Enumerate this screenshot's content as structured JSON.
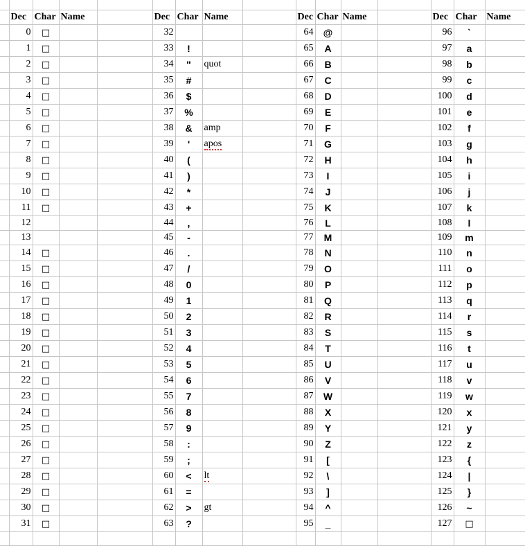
{
  "document": {
    "type": "spreadsheet",
    "title": "ASCII Character Table",
    "grid_line_color": "#c6c6c6",
    "page_break_color": "#8a8a8a",
    "background": "#ffffff",
    "spellcheck_underline_color": "#d03030"
  },
  "headers": {
    "dec": "Dec",
    "char": "Char",
    "name": "Name"
  },
  "groups": [
    {
      "id": "group-1",
      "header": {
        "dec": "Dec",
        "char": "Char",
        "name": "Name"
      },
      "rows": [
        {
          "dec": "0",
          "char": "□",
          "name": "",
          "box": true
        },
        {
          "dec": "1",
          "char": "□",
          "name": "",
          "box": true
        },
        {
          "dec": "2",
          "char": "□",
          "name": "",
          "box": true
        },
        {
          "dec": "3",
          "char": "□",
          "name": "",
          "box": true
        },
        {
          "dec": "4",
          "char": "□",
          "name": "",
          "box": true
        },
        {
          "dec": "5",
          "char": "□",
          "name": "",
          "box": true
        },
        {
          "dec": "6",
          "char": "□",
          "name": "",
          "box": true
        },
        {
          "dec": "7",
          "char": "□",
          "name": "",
          "box": true
        },
        {
          "dec": "8",
          "char": "□",
          "name": "",
          "box": true
        },
        {
          "dec": "9",
          "char": "□",
          "name": "",
          "box": true
        },
        {
          "dec": "10",
          "char": "□",
          "name": "",
          "box": true
        },
        {
          "dec": "11",
          "char": "□",
          "name": "",
          "box": true
        },
        {
          "dec": "12",
          "char": "",
          "name": ""
        },
        {
          "dec": "13",
          "char": "",
          "name": ""
        },
        {
          "dec": "14",
          "char": "□",
          "name": "",
          "box": true
        },
        {
          "dec": "15",
          "char": "□",
          "name": "",
          "box": true
        },
        {
          "dec": "16",
          "char": "□",
          "name": "",
          "box": true
        },
        {
          "dec": "17",
          "char": "□",
          "name": "",
          "box": true
        },
        {
          "dec": "18",
          "char": "□",
          "name": "",
          "box": true
        },
        {
          "dec": "19",
          "char": "□",
          "name": "",
          "box": true
        },
        {
          "dec": "20",
          "char": "□",
          "name": "",
          "box": true
        },
        {
          "dec": "21",
          "char": "□",
          "name": "",
          "box": true
        },
        {
          "dec": "22",
          "char": "□",
          "name": "",
          "box": true
        },
        {
          "dec": "23",
          "char": "□",
          "name": "",
          "box": true
        },
        {
          "dec": "24",
          "char": "□",
          "name": "",
          "box": true
        },
        {
          "dec": "25",
          "char": "□",
          "name": "",
          "box": true
        },
        {
          "dec": "26",
          "char": "□",
          "name": "",
          "box": true
        },
        {
          "dec": "27",
          "char": "□",
          "name": "",
          "box": true
        },
        {
          "dec": "28",
          "char": "□",
          "name": "",
          "box": true
        },
        {
          "dec": "29",
          "char": "□",
          "name": "",
          "box": true
        },
        {
          "dec": "30",
          "char": "□",
          "name": "",
          "box": true
        },
        {
          "dec": "31",
          "char": "□",
          "name": "",
          "box": true
        }
      ]
    },
    {
      "id": "group-2",
      "header": {
        "dec": "Dec",
        "char": "Char",
        "name": "Name"
      },
      "rows": [
        {
          "dec": "32",
          "char": "",
          "name": ""
        },
        {
          "dec": "33",
          "char": "!",
          "name": ""
        },
        {
          "dec": "34",
          "char": "\"",
          "name": "quot"
        },
        {
          "dec": "35",
          "char": "#",
          "name": ""
        },
        {
          "dec": "36",
          "char": "$",
          "name": ""
        },
        {
          "dec": "37",
          "char": "%",
          "name": ""
        },
        {
          "dec": "38",
          "char": "&",
          "name": "amp"
        },
        {
          "dec": "39",
          "char": "'",
          "name": "apos",
          "misspelled": true
        },
        {
          "dec": "40",
          "char": "(",
          "name": ""
        },
        {
          "dec": "41",
          "char": ")",
          "name": ""
        },
        {
          "dec": "42",
          "char": "*",
          "name": ""
        },
        {
          "dec": "43",
          "char": "+",
          "name": ""
        },
        {
          "dec": "44",
          "char": ",",
          "name": ""
        },
        {
          "dec": "45",
          "char": "-",
          "name": ""
        },
        {
          "dec": "46",
          "char": ".",
          "name": ""
        },
        {
          "dec": "47",
          "char": "/",
          "name": ""
        },
        {
          "dec": "48",
          "char": "0",
          "name": ""
        },
        {
          "dec": "49",
          "char": "1",
          "name": ""
        },
        {
          "dec": "50",
          "char": "2",
          "name": ""
        },
        {
          "dec": "51",
          "char": "3",
          "name": ""
        },
        {
          "dec": "52",
          "char": "4",
          "name": ""
        },
        {
          "dec": "53",
          "char": "5",
          "name": ""
        },
        {
          "dec": "54",
          "char": "6",
          "name": ""
        },
        {
          "dec": "55",
          "char": "7",
          "name": ""
        },
        {
          "dec": "56",
          "char": "8",
          "name": ""
        },
        {
          "dec": "57",
          "char": "9",
          "name": ""
        },
        {
          "dec": "58",
          "char": ":",
          "name": ""
        },
        {
          "dec": "59",
          "char": ";",
          "name": ""
        },
        {
          "dec": "60",
          "char": "<",
          "name": "lt",
          "misspelled": true
        },
        {
          "dec": "61",
          "char": "=",
          "name": ""
        },
        {
          "dec": "62",
          "char": ">",
          "name": "gt"
        },
        {
          "dec": "63",
          "char": "?",
          "name": ""
        }
      ]
    },
    {
      "id": "group-3",
      "header": {
        "dec": "Dec",
        "char": "Char",
        "name": "Name"
      },
      "rows": [
        {
          "dec": "64",
          "char": "@",
          "name": ""
        },
        {
          "dec": "65",
          "char": "A",
          "name": ""
        },
        {
          "dec": "66",
          "char": "B",
          "name": ""
        },
        {
          "dec": "67",
          "char": "C",
          "name": ""
        },
        {
          "dec": "68",
          "char": "D",
          "name": ""
        },
        {
          "dec": "69",
          "char": "E",
          "name": ""
        },
        {
          "dec": "70",
          "char": "F",
          "name": ""
        },
        {
          "dec": "71",
          "char": "G",
          "name": ""
        },
        {
          "dec": "72",
          "char": "H",
          "name": ""
        },
        {
          "dec": "73",
          "char": "I",
          "name": ""
        },
        {
          "dec": "74",
          "char": "J",
          "name": ""
        },
        {
          "dec": "75",
          "char": "K",
          "name": ""
        },
        {
          "dec": "76",
          "char": "L",
          "name": ""
        },
        {
          "dec": "77",
          "char": "M",
          "name": ""
        },
        {
          "dec": "78",
          "char": "N",
          "name": ""
        },
        {
          "dec": "79",
          "char": "O",
          "name": ""
        },
        {
          "dec": "80",
          "char": "P",
          "name": ""
        },
        {
          "dec": "81",
          "char": "Q",
          "name": ""
        },
        {
          "dec": "82",
          "char": "R",
          "name": ""
        },
        {
          "dec": "83",
          "char": "S",
          "name": ""
        },
        {
          "dec": "84",
          "char": "T",
          "name": ""
        },
        {
          "dec": "85",
          "char": "U",
          "name": ""
        },
        {
          "dec": "86",
          "char": "V",
          "name": ""
        },
        {
          "dec": "87",
          "char": "W",
          "name": ""
        },
        {
          "dec": "88",
          "char": "X",
          "name": ""
        },
        {
          "dec": "89",
          "char": "Y",
          "name": ""
        },
        {
          "dec": "90",
          "char": "Z",
          "name": ""
        },
        {
          "dec": "91",
          "char": "[",
          "name": ""
        },
        {
          "dec": "92",
          "char": "\\",
          "name": ""
        },
        {
          "dec": "93",
          "char": "]",
          "name": ""
        },
        {
          "dec": "94",
          "char": "^",
          "name": ""
        },
        {
          "dec": "95",
          "char": "_",
          "name": ""
        }
      ]
    },
    {
      "id": "group-4",
      "header": {
        "dec": "Dec",
        "char": "Char",
        "name": "Name"
      },
      "rows": [
        {
          "dec": "96",
          "char": "`",
          "name": ""
        },
        {
          "dec": "97",
          "char": "a",
          "name": ""
        },
        {
          "dec": "98",
          "char": "b",
          "name": ""
        },
        {
          "dec": "99",
          "char": "c",
          "name": ""
        },
        {
          "dec": "100",
          "char": "d",
          "name": ""
        },
        {
          "dec": "101",
          "char": "e",
          "name": ""
        },
        {
          "dec": "102",
          "char": "f",
          "name": ""
        },
        {
          "dec": "103",
          "char": "g",
          "name": ""
        },
        {
          "dec": "104",
          "char": "h",
          "name": ""
        },
        {
          "dec": "105",
          "char": "i",
          "name": ""
        },
        {
          "dec": "106",
          "char": "j",
          "name": ""
        },
        {
          "dec": "107",
          "char": "k",
          "name": ""
        },
        {
          "dec": "108",
          "char": "l",
          "name": ""
        },
        {
          "dec": "109",
          "char": "m",
          "name": ""
        },
        {
          "dec": "110",
          "char": "n",
          "name": ""
        },
        {
          "dec": "111",
          "char": "o",
          "name": ""
        },
        {
          "dec": "112",
          "char": "p",
          "name": ""
        },
        {
          "dec": "113",
          "char": "q",
          "name": ""
        },
        {
          "dec": "114",
          "char": "r",
          "name": ""
        },
        {
          "dec": "115",
          "char": "s",
          "name": ""
        },
        {
          "dec": "116",
          "char": "t",
          "name": ""
        },
        {
          "dec": "117",
          "char": "u",
          "name": ""
        },
        {
          "dec": "118",
          "char": "v",
          "name": ""
        },
        {
          "dec": "119",
          "char": "w",
          "name": ""
        },
        {
          "dec": "120",
          "char": "x",
          "name": ""
        },
        {
          "dec": "121",
          "char": "y",
          "name": ""
        },
        {
          "dec": "122",
          "char": "z",
          "name": ""
        },
        {
          "dec": "123",
          "char": "{",
          "name": ""
        },
        {
          "dec": "124",
          "char": "|",
          "name": ""
        },
        {
          "dec": "125",
          "char": "}",
          "name": ""
        },
        {
          "dec": "126",
          "char": "~",
          "name": ""
        },
        {
          "dec": "127",
          "char": "□",
          "name": "",
          "box": true
        }
      ]
    }
  ]
}
